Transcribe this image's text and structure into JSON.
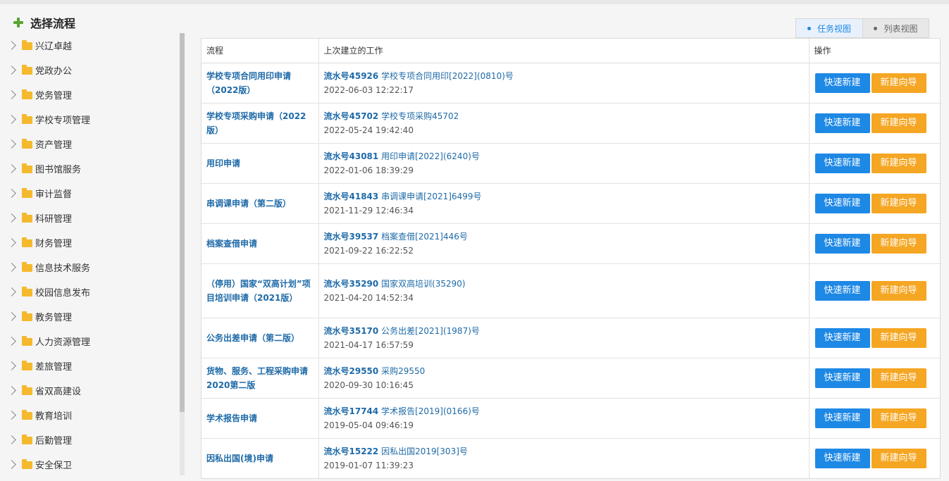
{
  "sidebar": {
    "title": "选择流程",
    "items": [
      "兴辽卓越",
      "党政办公",
      "党务管理",
      "学校专项管理",
      "资产管理",
      "图书馆服务",
      "审计监督",
      "科研管理",
      "财务管理",
      "信息技术服务",
      "校园信息发布",
      "教务管理",
      "人力资源管理",
      "差旅管理",
      "省双高建设",
      "教育培训",
      "后勤管理",
      "安全保卫"
    ]
  },
  "view_switch": {
    "task_view": "任务视图",
    "list_view": "列表视图"
  },
  "table": {
    "headers": [
      "流程",
      "上次建立的工作",
      "操作"
    ],
    "quick_label": "快速新建",
    "guide_label": "新建向导",
    "rows": [
      {
        "name": "学校专项合同用印申请（2022版）",
        "serial": "流水号45926",
        "title": "学校专项合同用印[2022](0810)号",
        "time": "2022-06-03 12:22:17"
      },
      {
        "name": "学校专项采购申请（2022版）",
        "serial": "流水号45702",
        "title": "学校专项采购45702",
        "time": "2022-05-24 19:42:40"
      },
      {
        "name": "用印申请",
        "serial": "流水号43081",
        "title": "用印申请[2022](6240)号",
        "time": "2022-01-06 18:39:29"
      },
      {
        "name": "串调课申请（第二版）",
        "serial": "流水号41843",
        "title": "串调课申请[2021]6499号",
        "time": "2021-11-29 12:46:34"
      },
      {
        "name": "档案查借申请",
        "serial": "流水号39537",
        "title": "档案查借[2021]446号",
        "time": "2021-09-22 16:22:52"
      },
      {
        "name": "（停用）国家“双高计划”项目培训申请（2021版）",
        "serial": "流水号35290",
        "title": "国家双高培训(35290)",
        "time": "2021-04-20 14:52:34"
      },
      {
        "name": "公务出差申请（第二版）",
        "serial": "流水号35170",
        "title": "公务出差[2021](1987)号",
        "time": "2021-04-17 16:57:59"
      },
      {
        "name": "货物、服务、工程采购申请2020第二版",
        "serial": "流水号29550",
        "title": "采购29550",
        "time": "2020-09-30 10:16:45"
      },
      {
        "name": "学术报告申请",
        "serial": "流水号17744",
        "title": "学术报告[2019](0166)号",
        "time": "2019-05-04 09:46:19"
      },
      {
        "name": "因私出国(境)申请",
        "serial": "流水号15222",
        "title": "因私出国2019[303]号",
        "time": "2019-01-07 11:39:23"
      }
    ]
  }
}
